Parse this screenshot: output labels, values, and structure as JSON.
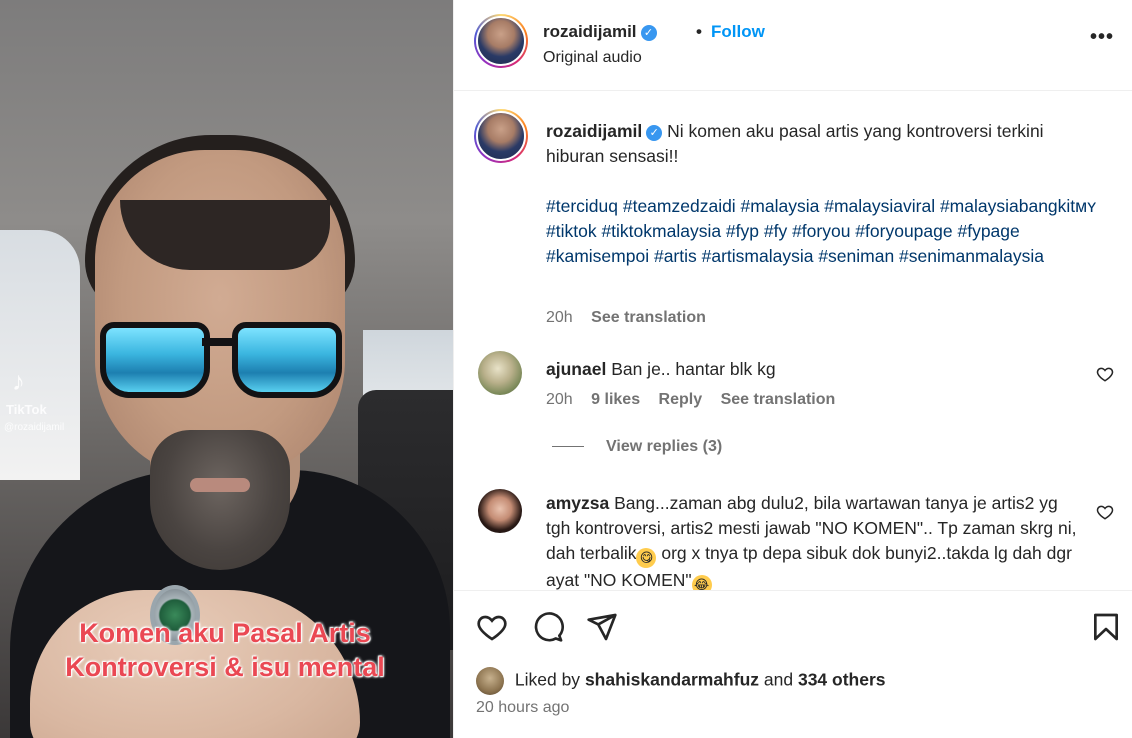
{
  "post": {
    "username": "rozaidijamil",
    "separator": "•",
    "follow_label": "Follow",
    "audio": "Original audio",
    "more": "•••"
  },
  "media": {
    "watermark_app": "TikTok",
    "watermark_handle": "@rozaidijamil",
    "caption_line1": "Komen aku Pasal Artis",
    "caption_line2": "Kontroversi & isu mental",
    "caption_color": "#ea4853"
  },
  "caption": {
    "username": "rozaidijamil",
    "text": "Ni komen aku pasal artis yang kontroversi terkini hiburan sensasi!!",
    "hashtags": "#terciduq #teamzedzaidi #malaysia #malaysiaviral #malaysiabangkitᴍʏ #tiktok #tiktokmalaysia #fyp #fy #foryou #foryoupage #fypage #kamisempoi #artis #artismalaysia #seniman #senimanmalaysia",
    "time": "20h",
    "see_translation": "See translation"
  },
  "comments": [
    {
      "username": "ajunael",
      "text": "Ban je.. hantar blk kg",
      "time": "20h",
      "likes": "9 likes",
      "reply": "Reply",
      "see_translation": "See translation",
      "view_replies": "View replies (3)"
    },
    {
      "username": "amyzsa",
      "text_part1": "Bang...zaman abg dulu2, bila wartawan tanya je artis2 yg tgh kontroversi, artis2 mesti jawab \"NO KOMEN\".. Tp zaman skrg ni, dah terbalik",
      "emoji1": "😋",
      "text_part2": " org x tnya tp depa sibuk dok bunyi2..takda lg dah dgr ayat \"NO KOMEN\"",
      "emoji2": "😂"
    }
  ],
  "likes": {
    "prefix": "Liked by",
    "user": "shahiskandarmahfuz",
    "and": "and",
    "others": "334 others"
  },
  "time_ago": "20 hours ago",
  "colors": {
    "link_blue": "#0095f6",
    "hashtag": "#00376b",
    "muted": "#737373",
    "verified": "#3897f0"
  }
}
